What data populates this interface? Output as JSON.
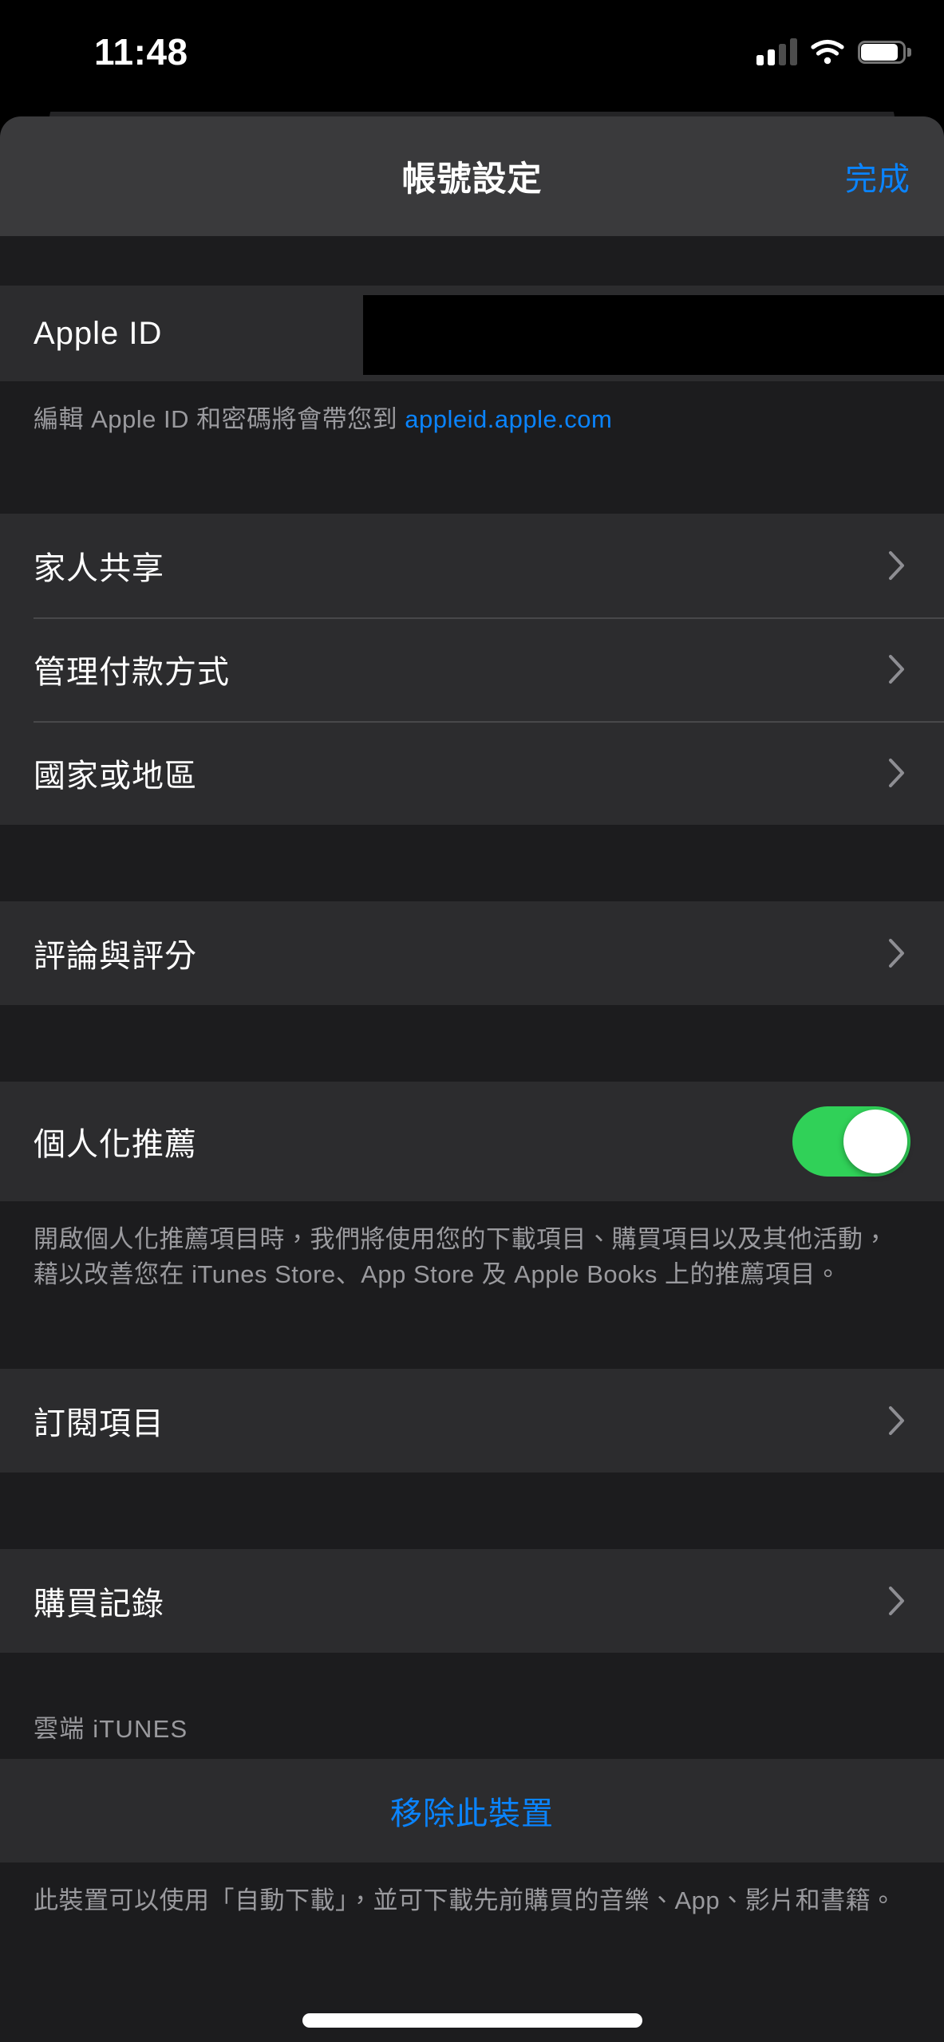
{
  "status_bar": {
    "time": "11:48",
    "signal_icon": "cellular-signal-icon",
    "signal_bars_filled": 2,
    "signal_bars_total": 4,
    "wifi_icon": "wifi-icon",
    "battery_icon": "battery-icon",
    "battery_level_percent": 88
  },
  "nav": {
    "title": "帳號設定",
    "done_label": "完成"
  },
  "apple_id_section": {
    "row_label": "Apple ID",
    "value_redacted": true,
    "footer_prefix": "編輯 Apple ID 和密碼將會帶您到 ",
    "footer_link": "appleid.apple.com"
  },
  "account_group": {
    "rows": [
      {
        "label": "家人共享",
        "accessory": "chevron-right-icon"
      },
      {
        "label": "管理付款方式",
        "accessory": "chevron-right-icon"
      },
      {
        "label": "國家或地區",
        "accessory": "chevron-right-icon"
      }
    ]
  },
  "reviews_group": {
    "rows": [
      {
        "label": "評論與評分",
        "accessory": "chevron-right-icon"
      }
    ]
  },
  "recommendations": {
    "label": "個人化推薦",
    "toggle_on": true,
    "toggle_color": "#30d158",
    "footer": "開啟個人化推薦項目時，我們將使用您的下載項目、購買項目以及其他活動，藉以改善您在 iTunes Store、App Store 及 Apple Books 上的推薦項目。"
  },
  "subscriptions_group": {
    "rows": [
      {
        "label": "訂閱項目",
        "accessory": "chevron-right-icon"
      }
    ]
  },
  "purchase_group": {
    "rows": [
      {
        "label": "購買記錄",
        "accessory": "chevron-right-icon"
      }
    ]
  },
  "itunes_cloud": {
    "header": "雲端 iTUNES",
    "action_label": "移除此裝置",
    "footer": "此裝置可以使用「自動下載」，並可下載先前購買的音樂、App、影片和書籍。"
  },
  "colors": {
    "accent_blue": "#0a84ff",
    "toggle_green": "#30d158",
    "row_background": "#2c2c2e",
    "page_background": "#1c1c1e",
    "navbar_background": "#3a3a3c",
    "secondary_text": "#9a9a9e"
  }
}
